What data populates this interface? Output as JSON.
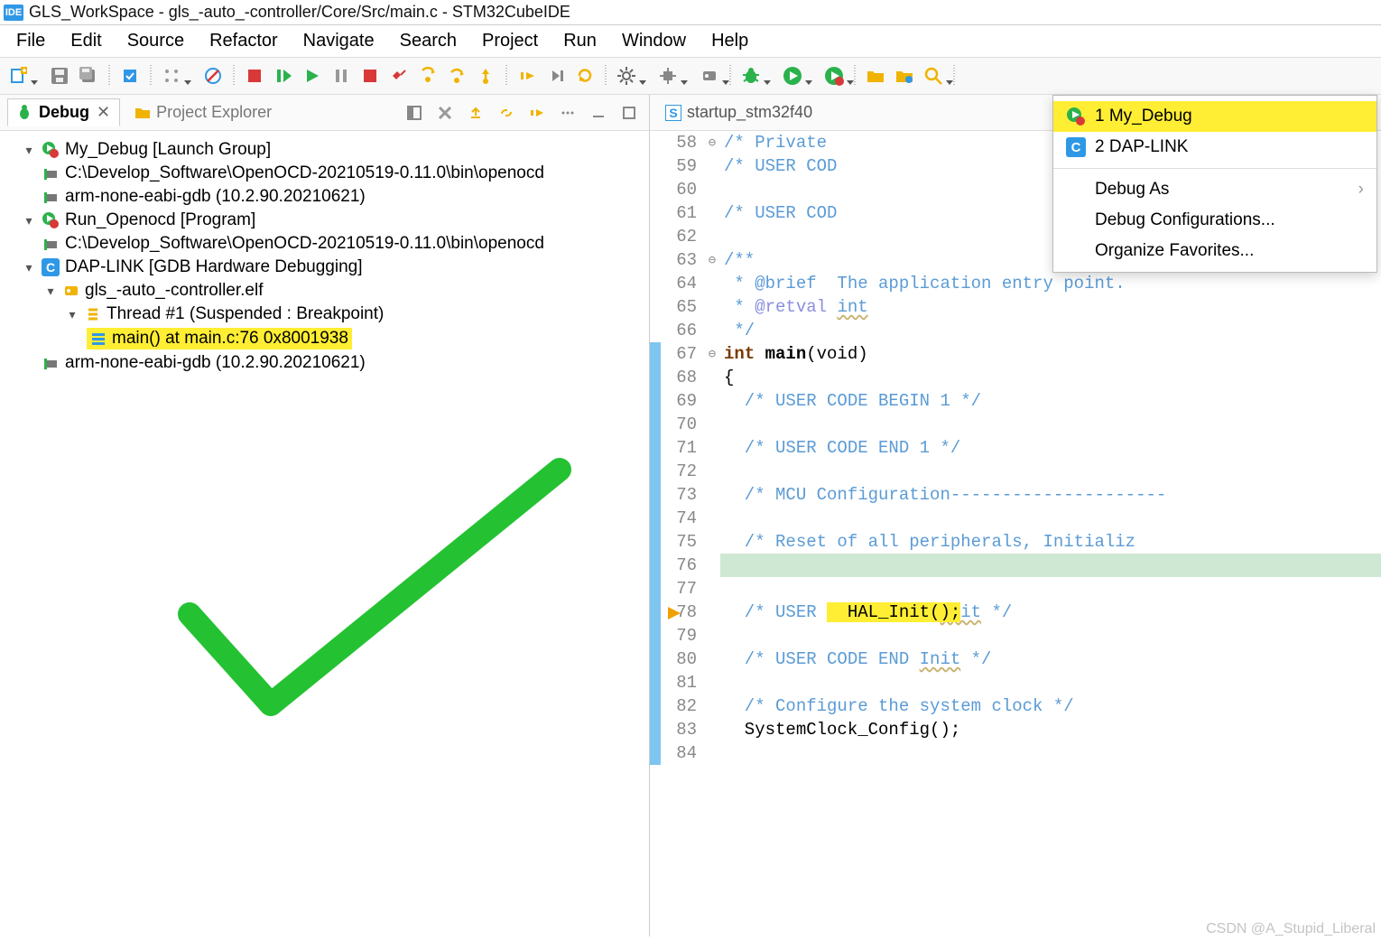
{
  "window": {
    "title": "GLS_WorkSpace - gls_-auto_-controller/Core/Src/main.c - STM32CubeIDE"
  },
  "menu": [
    "File",
    "Edit",
    "Source",
    "Refactor",
    "Navigate",
    "Search",
    "Project",
    "Run",
    "Window",
    "Help"
  ],
  "left_tabs": {
    "debug": "Debug",
    "explorer": "Project Explorer"
  },
  "debug_tree": {
    "n0": "My_Debug [Launch Group]",
    "n1": "C:\\Develop_Software\\OpenOCD-20210519-0.11.0\\bin\\openocd",
    "n2": "arm-none-eabi-gdb (10.2.90.20210621)",
    "n3": "Run_Openocd [Program]",
    "n4": "C:\\Develop_Software\\OpenOCD-20210519-0.11.0\\bin\\openocd",
    "n5": "DAP-LINK [GDB Hardware Debugging]",
    "n6": "gls_-auto_-controller.elf",
    "n7": "Thread #1 (Suspended : Breakpoint)",
    "n8": "main() at main.c:76 0x8001938",
    "n9": "arm-none-eabi-gdb (10.2.90.20210621)"
  },
  "editor_tab": "startup_stm32f40",
  "code": {
    "l58": "/* Private",
    "l59": "/* USER COD",
    "l60": "",
    "l61": "/* USER COD",
    "l62": "",
    "l63": "/**",
    "l64": " * @brief  The application entry point.",
    "l65": " * @retval int",
    "l66": " */",
    "l67a": "int ",
    "l67b": "main",
    "l67c": "(void)",
    "l68": "{",
    "l69": "  /* USER CODE BEGIN 1 */",
    "l70": "",
    "l71": "  /* USER CODE END 1 */",
    "l72": "",
    "l73": "  /* MCU Configuration---------------------",
    "l74": "",
    "l75": "  /* Reset of all peripherals, Initializ",
    "l76": "  HAL_Init();",
    "l77": "",
    "l78a": "  /* USER CODE BEGIN ",
    "l78b": "Init",
    "l78c": " */",
    "l79": "",
    "l80a": "  /* USER CODE END ",
    "l80b": "Init",
    "l80c": " */",
    "l81": "",
    "l82": "  /* Configure the system clock */",
    "l83": "  SystemClock_Config();",
    "l84": ""
  },
  "lines": [
    "58",
    "59",
    "60",
    "61",
    "62",
    "63",
    "64",
    "65",
    "66",
    "67",
    "68",
    "69",
    "70",
    "71",
    "72",
    "73",
    "74",
    "75",
    "76",
    "77",
    "78",
    "79",
    "80",
    "81",
    "82",
    "83",
    "84"
  ],
  "dropdown": {
    "item1": "1 My_Debug",
    "item2": "2 DAP-LINK",
    "debug_as": "Debug As",
    "debug_config": "Debug Configurations...",
    "organize": "Organize Favorites..."
  },
  "watermark": "CSDN @A_Stupid_Liberal"
}
